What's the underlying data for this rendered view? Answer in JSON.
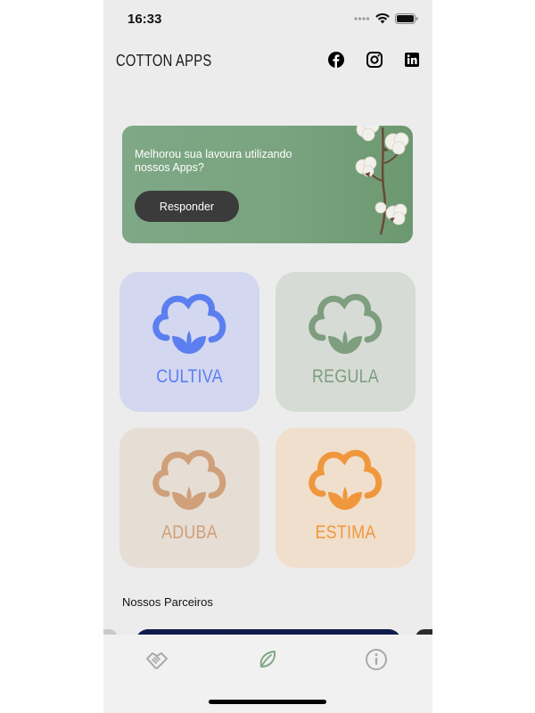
{
  "status": {
    "time": "16:33"
  },
  "header": {
    "brand": "COTTON APPS",
    "social": [
      "facebook-icon",
      "instagram-icon",
      "linkedin-icon"
    ]
  },
  "banner": {
    "text": "Melhorou sua lavoura utilizando nossos Apps?",
    "button": "Responder"
  },
  "apps": [
    {
      "label": "CULTIVA",
      "color": "#5b7ff0",
      "bg": "#d3d7f0"
    },
    {
      "label": "REGULA",
      "color": "#7e9e7f",
      "bg": "#d6dbd5"
    },
    {
      "label": "ADUBA",
      "color": "#cfa07a",
      "bg": "#e6ddd4"
    },
    {
      "label": "ESTIMA",
      "color": "#f0973e",
      "bg": "#f0dfcc"
    }
  ],
  "partners": {
    "title": "Nossos Parceiros"
  },
  "nav": {
    "items": [
      "handshake-icon",
      "leaf-icon",
      "info-icon"
    ],
    "active": 1,
    "active_color": "#7ea886"
  }
}
